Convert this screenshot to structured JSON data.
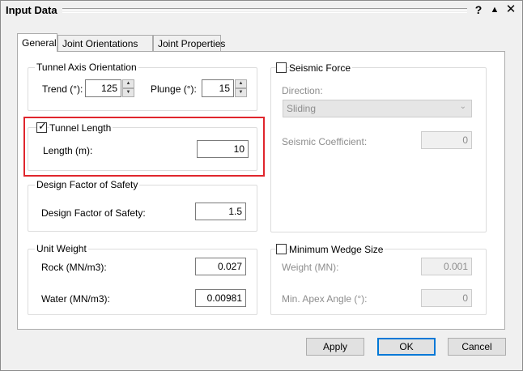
{
  "window": {
    "title": "Input Data",
    "help_icon": "?",
    "rollup_icon": "▲",
    "close_icon": "✕"
  },
  "tabs": [
    {
      "label": "General",
      "active": true
    },
    {
      "label": "Joint Orientations",
      "active": false
    },
    {
      "label": "Joint Properties",
      "active": false
    }
  ],
  "tunnel_axis": {
    "title": "Tunnel Axis Orientation",
    "trend_label": "Trend (°):",
    "trend_value": "125",
    "plunge_label": "Plunge (°):",
    "plunge_value": "15"
  },
  "tunnel_length": {
    "title": "Tunnel Length",
    "checked": true,
    "length_label": "Length (m):",
    "length_value": "10"
  },
  "design_fos": {
    "title": "Design Factor of Safety",
    "label": "Design Factor of Safety:",
    "value": "1.5"
  },
  "unit_weight": {
    "title": "Unit Weight",
    "rock_label": "Rock (MN/m3):",
    "rock_value": "0.027",
    "water_label": "Water (MN/m3):",
    "water_value": "0.00981"
  },
  "seismic": {
    "title": "Seismic Force",
    "checked": false,
    "direction_label": "Direction:",
    "direction_value": "Sliding",
    "coeff_label": "Seismic Coefficient:",
    "coeff_value": "0"
  },
  "min_wedge": {
    "title": "Minimum Wedge Size",
    "checked": false,
    "weight_label": "Weight (MN):",
    "weight_value": "0.001",
    "apex_label": "Min. Apex Angle (°):",
    "apex_value": "0"
  },
  "buttons": {
    "apply": "Apply",
    "ok": "OK",
    "cancel": "Cancel"
  },
  "colors": {
    "highlight": "#e0262d",
    "default_button_border": "#0078d7"
  }
}
